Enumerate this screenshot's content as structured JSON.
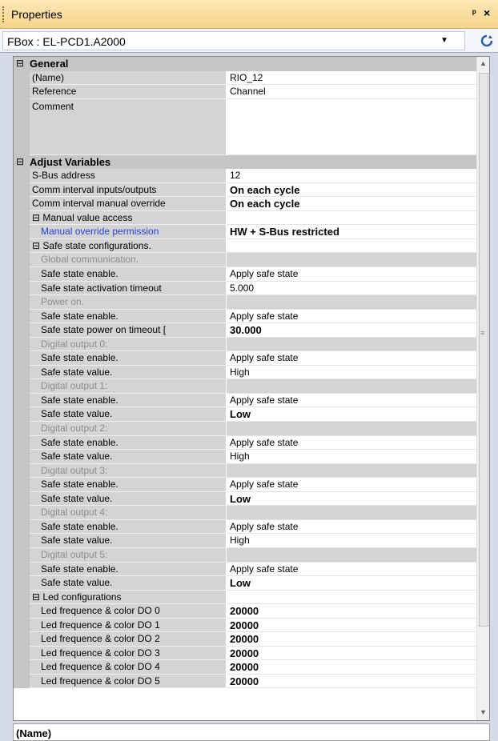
{
  "panel": {
    "title": "Properties",
    "pin_icon": "pin-icon",
    "close_icon": "close-icon"
  },
  "selector": {
    "value": "FBox : EL-PCD1.A2000",
    "refresh_icon": "refresh-icon"
  },
  "help": {
    "text": "(Name)"
  },
  "rows": [
    {
      "t": "cat",
      "text": "General"
    },
    {
      "t": "prop",
      "name": "(Name)",
      "value": "RIO_12"
    },
    {
      "t": "prop",
      "name": "Reference",
      "value": "Channel"
    },
    {
      "t": "tall",
      "name": "Comment",
      "value": ""
    },
    {
      "t": "cat",
      "text": "Adjust Variables"
    },
    {
      "t": "prop",
      "name": "S-Bus address",
      "value": "12"
    },
    {
      "t": "prop",
      "name": "Comm interval inputs/outputs",
      "value": "On each cycle",
      "bold": true
    },
    {
      "t": "prop",
      "name": "Comm interval manual override",
      "value": "On each cycle",
      "bold": true
    },
    {
      "t": "group",
      "name": "⊟ Manual value access",
      "value": ""
    },
    {
      "t": "sub",
      "name": "Manual override permission",
      "value": "HW + S-Bus restricted",
      "bold": true,
      "blue": true
    },
    {
      "t": "group",
      "name": "⊟ Safe state configurations.",
      "value": ""
    },
    {
      "t": "empty",
      "name": "Global communication."
    },
    {
      "t": "sub",
      "name": "Safe state enable.",
      "value": "Apply safe state"
    },
    {
      "t": "sub",
      "name": "Safe state activation timeout",
      "value": "5.000"
    },
    {
      "t": "empty",
      "name": "Power on."
    },
    {
      "t": "sub",
      "name": "Safe state enable.",
      "value": "Apply safe state"
    },
    {
      "t": "sub",
      "name": "Safe state power on timeout  [",
      "value": "30.000",
      "bold": true
    },
    {
      "t": "empty",
      "name": "Digital output 0:"
    },
    {
      "t": "sub",
      "name": "Safe state enable.",
      "value": "Apply safe state"
    },
    {
      "t": "sub",
      "name": "Safe state value.",
      "value": "High"
    },
    {
      "t": "empty",
      "name": "Digital output 1:"
    },
    {
      "t": "sub",
      "name": "Safe state enable.",
      "value": "Apply safe state"
    },
    {
      "t": "sub",
      "name": "Safe state value.",
      "value": "Low",
      "bold": true
    },
    {
      "t": "empty",
      "name": "Digital output 2:"
    },
    {
      "t": "sub",
      "name": "Safe state enable.",
      "value": "Apply safe state"
    },
    {
      "t": "sub",
      "name": "Safe state value.",
      "value": "High"
    },
    {
      "t": "empty",
      "name": "Digital output 3:"
    },
    {
      "t": "sub",
      "name": "Safe state enable.",
      "value": "Apply safe state"
    },
    {
      "t": "sub",
      "name": "Safe state value.",
      "value": "Low",
      "bold": true
    },
    {
      "t": "empty",
      "name": "Digital output 4:"
    },
    {
      "t": "sub",
      "name": "Safe state enable.",
      "value": "Apply safe state"
    },
    {
      "t": "sub",
      "name": "Safe state value.",
      "value": "High"
    },
    {
      "t": "empty",
      "name": "Digital output 5:"
    },
    {
      "t": "sub",
      "name": "Safe state enable.",
      "value": "Apply safe state"
    },
    {
      "t": "sub",
      "name": "Safe state value.",
      "value": "Low",
      "bold": true
    },
    {
      "t": "group",
      "name": "⊟ Led configurations",
      "value": ""
    },
    {
      "t": "sub",
      "name": "Led frequence & color DO 0",
      "value": "20000",
      "bold": true
    },
    {
      "t": "sub",
      "name": "Led frequence & color DO 1",
      "value": "20000",
      "bold": true
    },
    {
      "t": "sub",
      "name": "Led frequence & color DO 2",
      "value": "20000",
      "bold": true
    },
    {
      "t": "sub",
      "name": "Led frequence & color DO 3",
      "value": "20000",
      "bold": true
    },
    {
      "t": "sub",
      "name": "Led frequence & color DO 4",
      "value": "20000",
      "bold": true
    },
    {
      "t": "sub",
      "name": "Led frequence & color DO 5",
      "value": "20000",
      "bold": true
    }
  ]
}
